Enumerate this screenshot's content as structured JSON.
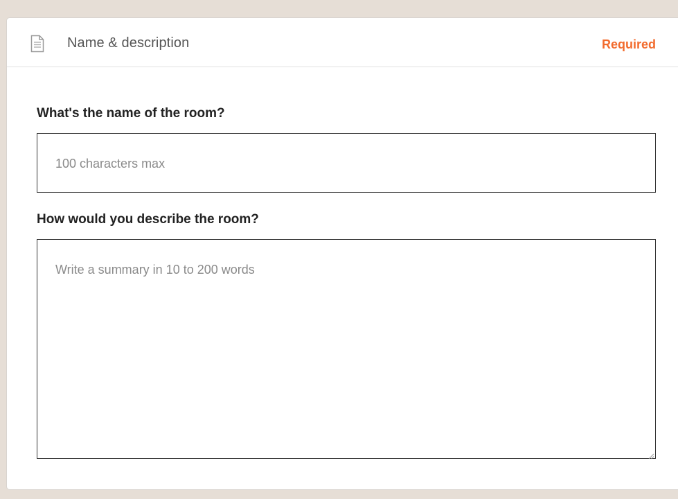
{
  "header": {
    "title": "Name & description",
    "required_label": "Required",
    "icon": "document-icon"
  },
  "fields": {
    "name": {
      "label": "What's the name of the room?",
      "placeholder": "100 characters max",
      "value": ""
    },
    "description": {
      "label": "How would you describe the room?",
      "placeholder": "Write a summary in 10 to 200 words",
      "value": ""
    }
  },
  "colors": {
    "accent": "#f26b2d",
    "page_background": "#e6ded6",
    "card_background": "#ffffff",
    "input_border": "#333333"
  }
}
